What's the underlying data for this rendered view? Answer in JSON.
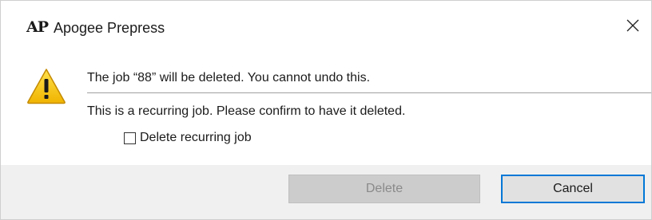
{
  "window": {
    "logo_text": "AP",
    "title": "Apogee Prepress",
    "close_icon": "close-icon"
  },
  "message": {
    "icon": "warning-icon",
    "primary": "The job “88” will be deleted. You cannot undo this.",
    "secondary": "This is a recurring job. Please confirm to have it deleted."
  },
  "checkbox": {
    "label": "Delete recurring job",
    "checked": false
  },
  "buttons": {
    "delete_label": "Delete",
    "delete_enabled": false,
    "cancel_label": "Cancel"
  },
  "colors": {
    "focus_border": "#0078d7",
    "footer_bg": "#f0f0f0",
    "warning_yellow": "#f5c400"
  }
}
